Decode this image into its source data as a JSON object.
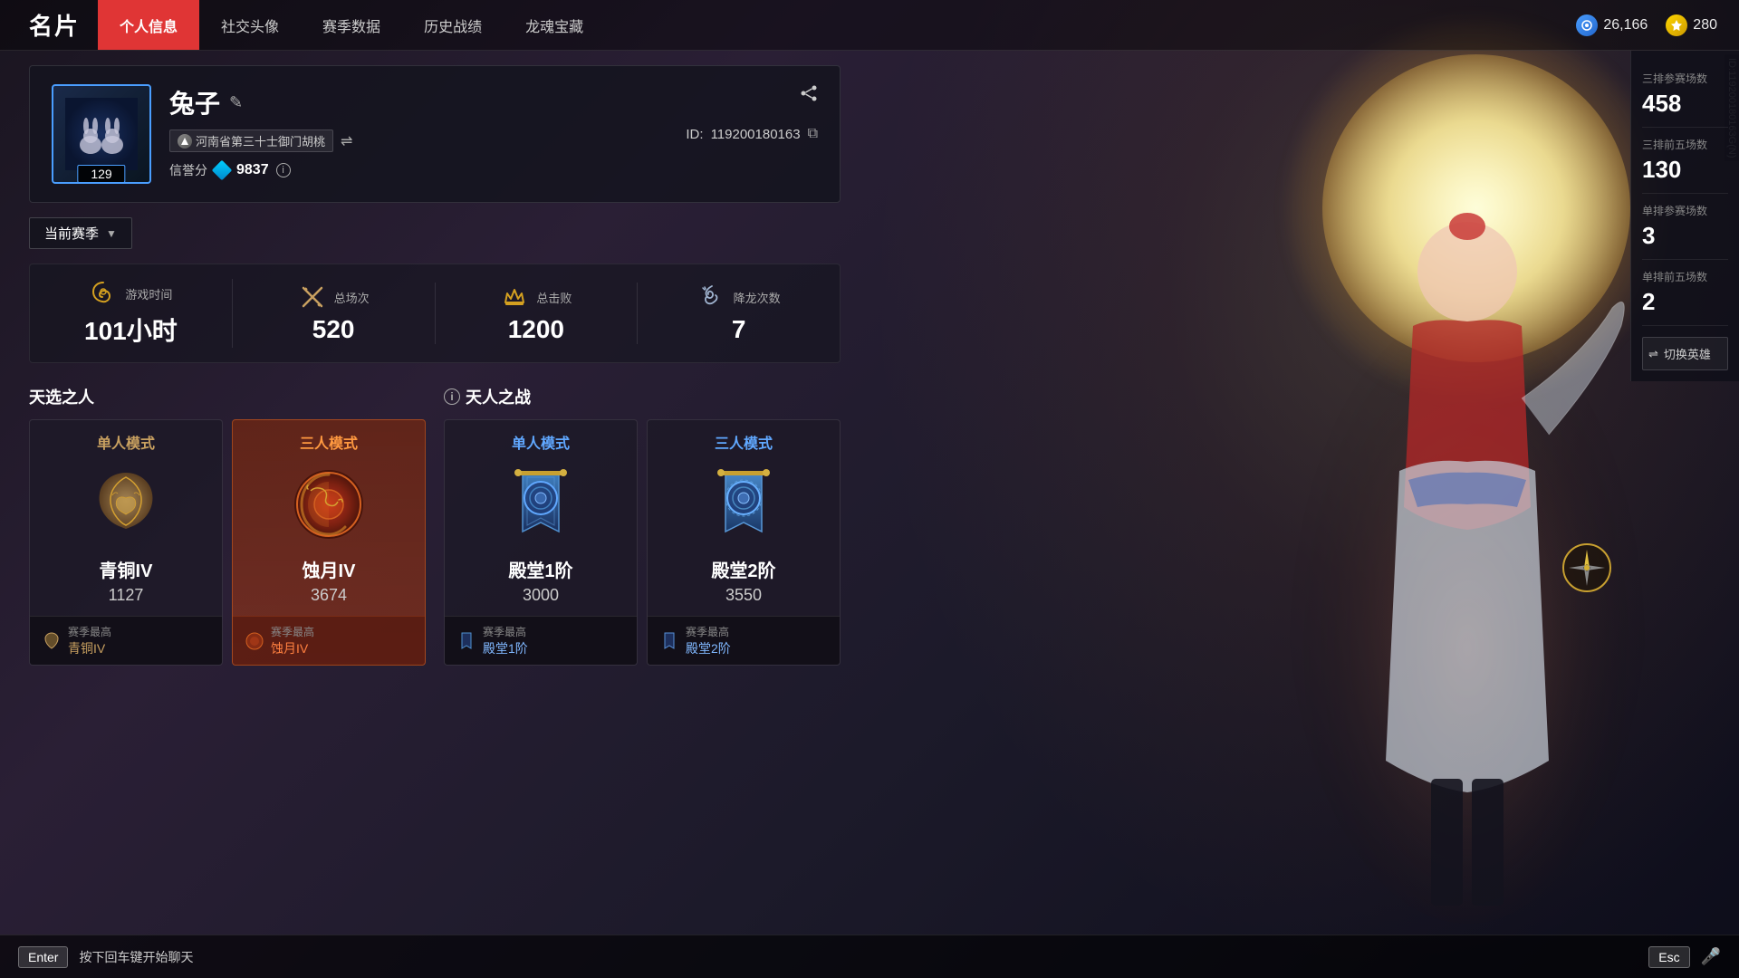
{
  "page": {
    "title": "名片"
  },
  "nav": {
    "tabs": [
      {
        "id": "personal",
        "label": "个人信息",
        "active": true
      },
      {
        "id": "social",
        "label": "社交头像",
        "active": false
      },
      {
        "id": "season",
        "label": "赛季数据",
        "active": false
      },
      {
        "id": "history",
        "label": "历史战绩",
        "active": false
      },
      {
        "id": "dragon",
        "label": "龙魂宝藏",
        "active": false
      }
    ]
  },
  "currency": {
    "blue": "26,166",
    "gold": "280"
  },
  "profile": {
    "name": "兔子",
    "level": "129",
    "region": "河南省第三十士御门胡桃",
    "credit_label": "信誉分",
    "credit_value": "9837",
    "id_label": "ID:",
    "id_value": "119200180163",
    "edit_label": "编辑"
  },
  "season": {
    "selector_label": "当前赛季"
  },
  "stats": [
    {
      "icon": "spiral",
      "label": "游戏时间",
      "value": "101小时"
    },
    {
      "icon": "swords",
      "label": "总场次",
      "value": "520"
    },
    {
      "icon": "crown",
      "label": "总击败",
      "value": "1200"
    },
    {
      "icon": "dragon",
      "label": "降龙次数",
      "value": "7"
    }
  ],
  "tianxuan": {
    "title": "天选之人",
    "cards": [
      {
        "mode": "单人模式",
        "mode_color": "bronze",
        "rank_name": "青铜IV",
        "rank_score": "1127",
        "season_best_label": "赛季最高",
        "season_best": "青铜IV",
        "highlighted": false
      },
      {
        "mode": "三人模式",
        "mode_color": "orange",
        "rank_name": "蚀月IV",
        "rank_score": "3674",
        "season_best_label": "赛季最高",
        "season_best": "蚀月IV",
        "highlighted": true
      }
    ]
  },
  "tianren": {
    "title": "天人之战",
    "cards": [
      {
        "mode": "单人模式",
        "mode_color": "blue",
        "rank_name": "殿堂1阶",
        "rank_score": "3000",
        "season_best_label": "赛季最高",
        "season_best": "殿堂1阶",
        "highlighted": false
      },
      {
        "mode": "三人模式",
        "mode_color": "blue",
        "rank_name": "殿堂2阶",
        "rank_score": "3550",
        "season_best_label": "赛季最高",
        "season_best": "殿堂2阶",
        "highlighted": false
      }
    ]
  },
  "right_panel": {
    "stats": [
      {
        "label": "三排参赛场数",
        "value": "458"
      },
      {
        "label": "三排前五场数",
        "value": "130"
      },
      {
        "label": "单排参赛场数",
        "value": "3"
      },
      {
        "label": "单排前五场数",
        "value": "2"
      }
    ],
    "switch_btn": "切换英雄"
  },
  "bottom": {
    "enter_key": "Enter",
    "hint": "按下回车键开始聊天",
    "esc_key": "Esc"
  }
}
